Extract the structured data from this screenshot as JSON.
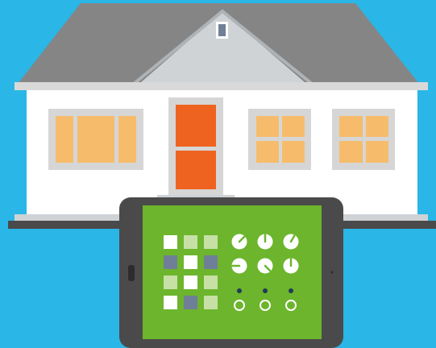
{
  "colors": {
    "sky": "#2ab6e6",
    "roof": "#858585",
    "gable": "#cfd3d6",
    "wall": "#ffffff",
    "trim": "#d6d6d6",
    "window": "#f7bc6b",
    "door": "#ef6320",
    "ground": "#4a4a4a",
    "tablet": "#4b4a4a",
    "screen": "#6cb52c",
    "tile_white": "#ffffff",
    "tile_light": "#c7e0a6",
    "tile_blue": "#6f7f97",
    "dot_navy": "#1f3b58"
  },
  "controls": {
    "grid": [
      [
        "white",
        "light",
        "light"
      ],
      [
        "blue",
        "white",
        "blue"
      ],
      [
        "light",
        "white",
        "light"
      ],
      [
        "white",
        "blue",
        "light"
      ]
    ],
    "dials": [
      {
        "label": "dial-1",
        "angle": 45
      },
      {
        "label": "dial-2",
        "angle": 0
      },
      {
        "label": "dial-3",
        "angle": 30
      },
      {
        "label": "dial-4",
        "angle": 270
      },
      {
        "label": "dial-5",
        "angle": 135
      },
      {
        "label": "dial-6",
        "angle": 0
      }
    ],
    "toggles": [
      {
        "label": "toggle-1"
      },
      {
        "label": "toggle-2"
      },
      {
        "label": "toggle-3"
      }
    ]
  }
}
